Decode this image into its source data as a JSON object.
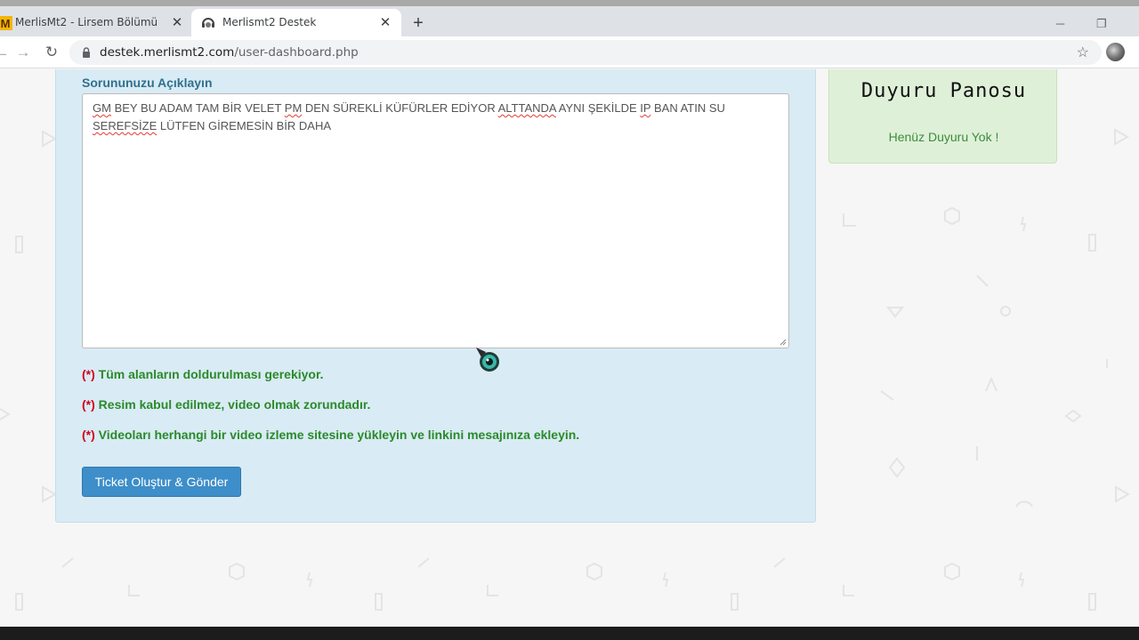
{
  "browser": {
    "tabs": [
      {
        "title": "MerlisMt2 - Lirsem Bölümü",
        "favicon_letter": "M"
      },
      {
        "title": "Merlismt2 Destek"
      }
    ],
    "url_host": "destek.merlismt2.com",
    "url_path": "/user-dashboard.php"
  },
  "form": {
    "description_label": "Sorununuzu Açıklayın",
    "textarea_text": {
      "line1": [
        {
          "t": "GM",
          "err": true
        },
        {
          "t": " BEY BU ADAM TAM BİR VELET ",
          "err": false
        },
        {
          "t": "PM",
          "err": true
        },
        {
          "t": " DEN SÜREKLİ KÜFÜRLER EDİYOR ",
          "err": false
        },
        {
          "t": "ALTTANDA",
          "err": true
        },
        {
          "t": " AYNI ŞEKİLDE ",
          "err": false
        },
        {
          "t": "IP",
          "err": true
        },
        {
          "t": " BAN ATIN SU",
          "err": false
        }
      ],
      "line2": [
        {
          "t": "SEREFSİZE",
          "err": true
        },
        {
          "t": " LÜTFEN GİREMESİN BİR DAHA",
          "err": false
        }
      ]
    },
    "notes": [
      {
        "mark": "(*)",
        "text": " Tüm alanların doldurulması gerekiyor."
      },
      {
        "mark": "(*)",
        "text": " Resim kabul edilmez, video olmak zorundadır."
      },
      {
        "mark": "(*)",
        "text": " Videoları herhangi bir video izleme sitesine yükleyin ve linkini mesajınıza ekleyin."
      }
    ],
    "submit_label": "Ticket Oluştur & Gönder"
  },
  "announcements": {
    "title": "Duyuru Panosu",
    "empty_text": "Henüz Duyuru Yok !"
  },
  "colors": {
    "panel_bg": "#d9ebf4",
    "label_blue": "#31708f",
    "note_green": "#2a8a2a",
    "required_red": "#d0021b",
    "button_blue": "#3d8ec9",
    "announce_bg": "#dff0d8"
  }
}
